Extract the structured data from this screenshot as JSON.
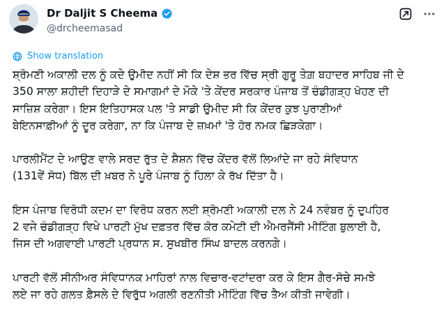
{
  "author": {
    "name": "Dr Daljit S Cheema",
    "handle": "@drcheemasad",
    "verified": true
  },
  "header_actions": [
    {
      "icon": "grok-icon"
    },
    {
      "icon": "more-options-icon"
    }
  ],
  "translate": {
    "icon": "globe-icon",
    "label": "Show translation"
  },
  "tweet": {
    "paragraphs": [
      [
        "ਸ਼੍ਰੋਮਣੀ ਅਕਾਲੀ ਦਲ ਨੂੰ ਕਦੇ ਉਮੀਦ ਨਹੀਂ ਸੀ ਕਿ ਦੇਸ਼ ਭਰ ਵਿੱਚ ਸ੍ਰੀ ਗੁਰੂ ਤੇਗ਼ ਬਹਾਦਰ ਸਾਹਿਬ ਜੀ ਦੇ",
        "350 ਸਾਲਾ ਸ਼ਹੀਦੀ ਦਿਹਾੜੇ ਦੇ ਸਮਾਗਮਾਂ ਦੇ ਮੌਕੇ 'ਤੇ ਕੇਂਦਰ ਸਰਕਾਰ ਪੰਜਾਬ ਤੋਂ ਚੰਡੀਗੜ੍ਹ ਖੋਹਣ ਦੀ",
        "ਸਾਜ਼ਿਸ਼ ਕਰੇਗਾ। ਇਸ ਇਤਿਹਾਸਕ ਪਲ 'ਤੇ ਸਾਡੀ ਉਮੀਦ ਸੀ ਕਿ ਕੇਂਦਰ ਕੁਝ ਪੁਰਾਣੀਆਂ",
        "ਬੇਇਨਸਾਫ਼ੀਆਂ ਨੂੰ ਦੂਰ ਕਰੇਗਾ, ਨਾ ਕਿ ਪੰਜਾਬ ਦੇ ਜ਼ਖ਼ਮਾਂ 'ਤੇ ਹੋਰ ਨਮਕ ਛਿੜਕੇਗਾ।"
      ],
      [
        "ਪਾਰਲੀਮੈਂਟ ਦੇ ਆਉਣ ਵਾਲੇ ਸਰਦ ਰੁੱਤ ਦੇ ਸ਼ੈਸ਼ਨ ਵਿੱਚ ਕੇਂਦਰ ਵੱਲੋਂ ਲਿਆਂਦੇ ਜਾ ਰਹੇ ਸੰਵਿਧਾਨ",
        "(131ਵੇਂ ਸੋਧ) ਬਿੱਲ ਦੀ ਖ਼ਬਰ ਨੇ ਪੂਰੇ ਪੰਜਾਬ ਨੂੰ ਹਿਲਾ ਕੇ ਰੱਖ ਦਿੱਤਾ ਹੈ।"
      ],
      [
        "ਇਸ ਪੰਜਾਬ ਵਿਰੋਧੀ ਕਦਮ ਦਾ ਵਿਰੋਧ ਕਰਨ ਲਈ ਸ਼੍ਰੋਮਣੀ ਅਕਾਲੀ ਦਲ ਨੇ 24 ਨਵੰਬਰ ਨੂੰ ਦੁਪਹਿਰ",
        "2 ਵਜੇ ਚੰਡੀਗੜ੍ਹ ਵਿਖੇ ਪਾਰਟੀ ਮੁੱਖ ਦਫ਼ਤਰ ਵਿੱਚ ਕੋਰ ਕਮੇਟੀ ਦੀ ਐਮਰਜੈਂਸੀ ਮੀਟਿੰਗ ਬੁਲਾਈ ਹੈ,",
        "ਜਿਸ ਦੀ ਅਗਵਾਈ ਪਾਰਟੀ ਪ੍ਰਧਾਨ ਸ. ਸੁਖਬੀਰ ਸਿੰਘ ਬਾਦਲ ਕਰਨਗੇ।"
      ],
      [
        "ਪਾਰਟੀ ਵੱਲੋਂ ਸੀਨੀਅਰ ਸੰਵਿਧਾਨਕ ਮਾਹਿਰਾਂ ਨਾਲ ਵਿਚਾਰ-ਵਟਾਂਦਰਾ ਕਰ ਕੇ ਇਸ ਗੈਰ-ਸੋਚੇ ਸਮਝੇ",
        "ਲਏ ਜਾ ਰਹੇ ਗਲਤ ਫ਼ੈਸਲੇ ਦੇ ਵਿਰੁੱਧ ਅਗਲੀ ਰਣਨੀਤੀ ਮੀਟਿੰਗ ਵਿੱਚ ਤੈਅ ਕੀਤੀ ਜਾਵੇਗੀ।"
      ]
    ]
  },
  "colors": {
    "link": "#1d9bf0",
    "text": "#0f1419",
    "secondary": "#536471",
    "verified": "#1d9bf0",
    "turban": "#0b2a6b"
  }
}
